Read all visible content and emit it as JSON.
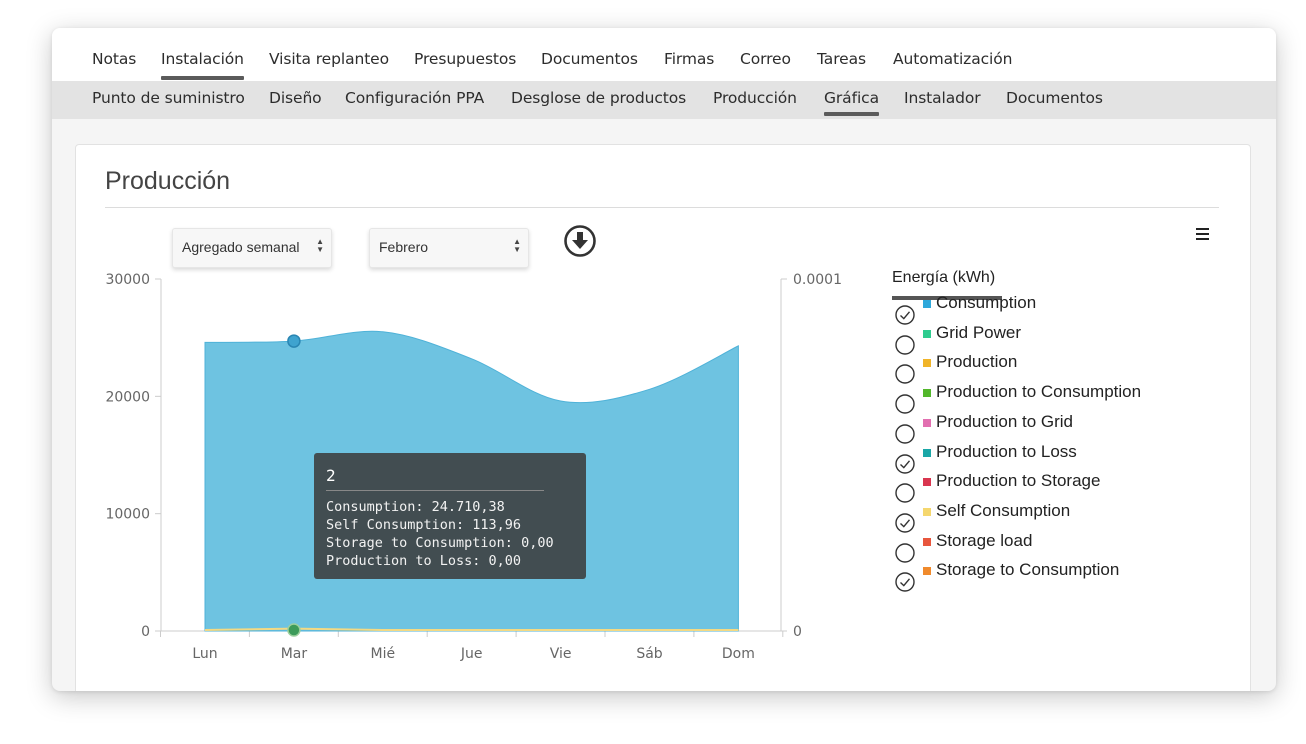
{
  "main_tabs": [
    {
      "label": "Notas",
      "active": false
    },
    {
      "label": "Instalación",
      "active": true
    },
    {
      "label": "Visita replanteo",
      "active": false
    },
    {
      "label": "Presupuestos",
      "active": false
    },
    {
      "label": "Documentos",
      "active": false
    },
    {
      "label": "Firmas",
      "active": false
    },
    {
      "label": "Correo",
      "active": false
    },
    {
      "label": "Tareas",
      "active": false
    },
    {
      "label": "Automatización",
      "active": false
    }
  ],
  "sub_tabs": [
    {
      "label": "Punto de suministro",
      "active": false
    },
    {
      "label": "Diseño",
      "active": false
    },
    {
      "label": "Configuración PPA",
      "active": false
    },
    {
      "label": "Desglose de productos",
      "active": false
    },
    {
      "label": "Producción",
      "active": false
    },
    {
      "label": "Gráfica",
      "active": true
    },
    {
      "label": "Instalador",
      "active": false
    },
    {
      "label": "Documentos",
      "active": false
    }
  ],
  "card": {
    "title": "Producción"
  },
  "controls": {
    "aggregation": {
      "value": "Agregado semanal"
    },
    "month": {
      "value": "Febrero"
    },
    "download_icon": "arrow-down-circle-icon",
    "menu_icon": "hamburger-icon"
  },
  "chart_data": {
    "type": "area",
    "categories": [
      "Lun",
      "Mar",
      "Mié",
      "Jue",
      "Vie",
      "Sáb",
      "Dom"
    ],
    "series": [
      {
        "name": "Consumption",
        "values": [
          24600,
          24710.38,
          25500,
          23200,
          19600,
          20600,
          24300
        ],
        "color": "#6ec3e1"
      },
      {
        "name": "Self Consumption",
        "values": [
          0,
          113.96,
          0,
          0,
          0,
          0,
          0
        ],
        "color": "#f3d983"
      }
    ],
    "y_left": {
      "min": 0,
      "max": 30000,
      "ticks": [
        "0",
        "10000",
        "20000",
        "30000"
      ]
    },
    "y_right": {
      "ticks": [
        "0",
        "0.0001"
      ]
    },
    "highlighted_point": {
      "category": "Mar",
      "value": 24710.38
    },
    "legend": {
      "title": "Energía (kWh)",
      "placement": "right",
      "items": [
        {
          "label": "Consumption",
          "color": "#2ea8db",
          "checked": true
        },
        {
          "label": "Grid Power",
          "color": "#2ecc8f",
          "checked": false
        },
        {
          "label": "Production",
          "color": "#f0b429",
          "checked": false
        },
        {
          "label": "Production to Consumption",
          "color": "#52b72b",
          "checked": false
        },
        {
          "label": "Production to Grid",
          "color": "#e26fb0",
          "checked": false
        },
        {
          "label": "Production to Loss",
          "color": "#1aa7a7",
          "checked": true
        },
        {
          "label": "Production to Storage",
          "color": "#d9364f",
          "checked": false
        },
        {
          "label": "Self Consumption",
          "color": "#f5d76e",
          "checked": true
        },
        {
          "label": "Storage load",
          "color": "#e8563d",
          "checked": false
        },
        {
          "label": "Storage to Consumption",
          "color": "#f08a2c",
          "checked": true
        }
      ]
    },
    "tooltip": {
      "title": "2",
      "rows": [
        "Consumption: 24.710,38",
        "Self Consumption: 113,96",
        "Storage to Consumption: 0,00",
        "Production to Loss: 0,00"
      ]
    }
  }
}
